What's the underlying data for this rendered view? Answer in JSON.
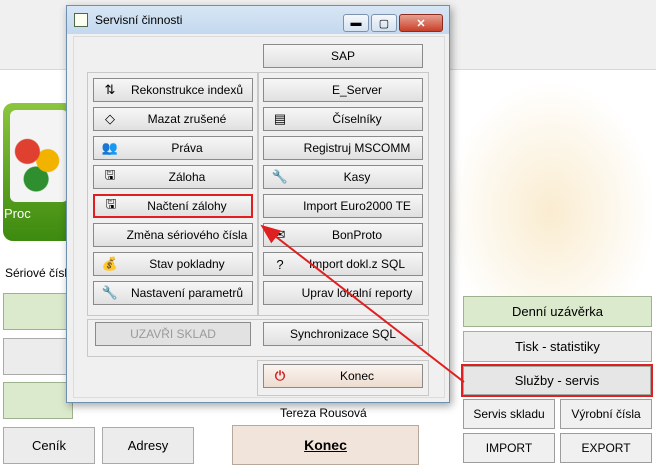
{
  "background": {
    "product_tile_text": "Proc",
    "serial_label": "Sériové čísl",
    "buttons": {
      "denni": "Denní uzávěrka",
      "tisk": "Tisk - statistiky",
      "sluzby": "Služby - servis",
      "servis_skladu": "Servis skladu",
      "vyrobni": "Výrobní čísla",
      "import": "IMPORT",
      "export": "EXPORT",
      "cenik": "Ceník",
      "adresy": "Adresy",
      "konec": "Konec",
      "user": "Tereza Rousová"
    }
  },
  "dialog": {
    "title": "Servisní činnosti",
    "window_controls": {
      "minimize": "▬",
      "maximize": "▢",
      "close": "✕"
    },
    "left_buttons": [
      {
        "label": "Rekonstrukce indexů",
        "icon": "sort-icon",
        "glyph": "⇅"
      },
      {
        "label": "Mazat zrušené",
        "icon": "eraser-icon",
        "glyph": "◇"
      },
      {
        "label": "Práva",
        "icon": "users-icon",
        "glyph": "👥"
      },
      {
        "label": "Záloha",
        "icon": "computer-disk-icon",
        "glyph": "🖫"
      },
      {
        "label": "Načtení zálohy",
        "icon": "disk-computer-icon",
        "glyph": "🖫"
      },
      {
        "label": "Změna sériového čísla",
        "icon": "",
        "glyph": ""
      },
      {
        "label": "Stav pokladny",
        "icon": "money-bag-icon",
        "glyph": "💰"
      },
      {
        "label": "Nastavení parametrů",
        "icon": "wrench-icon",
        "glyph": "🔧"
      }
    ],
    "right_buttons": [
      {
        "label": "E_Server",
        "icon": "",
        "glyph": ""
      },
      {
        "label": "Číselníky",
        "icon": "documents-icon",
        "glyph": "▤"
      },
      {
        "label": "Registruj MSCOMM",
        "icon": "",
        "glyph": ""
      },
      {
        "label": "Kasy",
        "icon": "wrench-icon",
        "glyph": "🔧"
      },
      {
        "label": "Import Euro2000 TE",
        "icon": "",
        "glyph": ""
      },
      {
        "label": "BonProto",
        "icon": "envelope-icon",
        "glyph": "✉"
      },
      {
        "label": "Import dokl.z SQL",
        "icon": "question-computer-icon",
        "glyph": "?"
      },
      {
        "label": "Uprav lokalní reporty",
        "icon": "",
        "glyph": ""
      }
    ],
    "sap": "SAP",
    "uzavri": "UZAVŘI SKLAD",
    "sync": "Synchronizace SQL",
    "konec": "Konec",
    "konec_glyph": "⏻"
  },
  "colors": {
    "highlight": "#e02020",
    "green": "#dbe9cc",
    "pink": "#f1e4da"
  }
}
